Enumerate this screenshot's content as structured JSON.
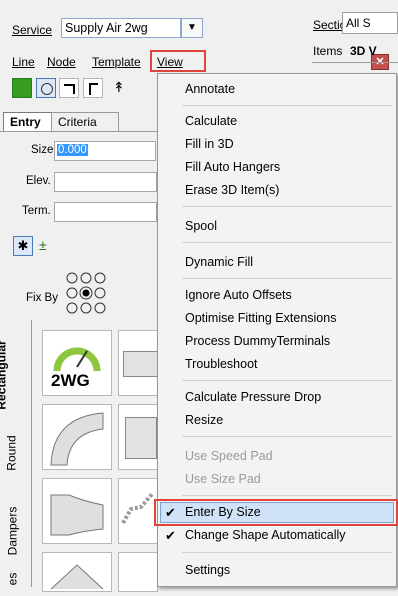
{
  "service": {
    "label": "Service",
    "value": "Supply Air  2wg"
  },
  "menubar": {
    "line": "Line",
    "node": "Node",
    "template": "Template",
    "view": "View"
  },
  "tabs": {
    "entry": "Entry",
    "criteria": "Criteria"
  },
  "fields": {
    "size_label": "Size",
    "size_value": "0.000",
    "elev_label": "Elev.",
    "term_label": "Term.",
    "fixby_label": "Fix By"
  },
  "side_tabs": {
    "rectangular": "Rectangular",
    "round": "Round",
    "dampers": "Dampers",
    "partial": "es"
  },
  "tile_badge": "2WG",
  "right_panel": {
    "section_label": "Section",
    "section_value": "All S",
    "tab_items": "Items",
    "tab_3d": "3D V"
  },
  "menu": {
    "annotate": "Annotate",
    "calculate": "Calculate",
    "fill_in_3d": "Fill in 3D",
    "fill_auto_hangers": "Fill Auto Hangers",
    "erase_3d_items": "Erase 3D Item(s)",
    "spool": "Spool",
    "dynamic_fill": "Dynamic Fill",
    "ignore_auto_offsets": "Ignore Auto Offsets",
    "optimise_fitting_extensions": "Optimise Fitting Extensions",
    "process_dummy_terminals": "Process DummyTerminals",
    "troubleshoot": "Troubleshoot",
    "calculate_pressure_drop": "Calculate Pressure Drop",
    "resize": "Resize",
    "use_speed_pad": "Use Speed Pad",
    "use_size_pad": "Use Size Pad",
    "enter_by_size": "Enter By Size",
    "change_shape_automatically": "Change Shape Automatically",
    "settings": "Settings"
  },
  "checked": {
    "enter_by_size": true,
    "change_shape_automatically": true
  },
  "colors": {
    "highlight": "#cfe2f7",
    "annotation_box": "#e0443c"
  }
}
